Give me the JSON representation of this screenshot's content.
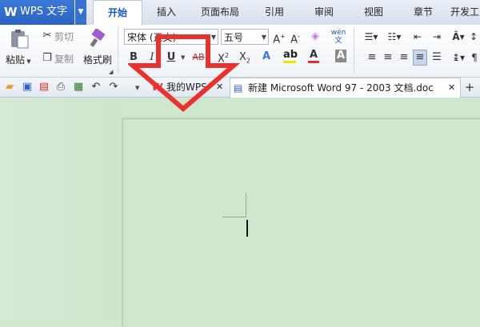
{
  "app": {
    "title": "WPS 文字",
    "logo": "W"
  },
  "tabs": [
    {
      "label": "开始",
      "active": true
    },
    {
      "label": "插入"
    },
    {
      "label": "页面布局"
    },
    {
      "label": "引用"
    },
    {
      "label": "审阅"
    },
    {
      "label": "视图"
    },
    {
      "label": "章节"
    },
    {
      "label": "开发工"
    }
  ],
  "ribbon": {
    "clipboard": {
      "paste": "粘贴",
      "cut": "剪切",
      "copy": "复制",
      "format_painter": "格式刷"
    },
    "font": {
      "name": "宋体 (正文)",
      "size": "五号"
    }
  },
  "doc_tabs": [
    {
      "label": "我的WPS"
    },
    {
      "label": "新建 Microsoft Word 97 - 2003 文档.doc",
      "active": true
    }
  ],
  "colors": {
    "accent": "#2a63c2",
    "arrow": "#e8322e",
    "canvas": "#cfe6cf"
  }
}
